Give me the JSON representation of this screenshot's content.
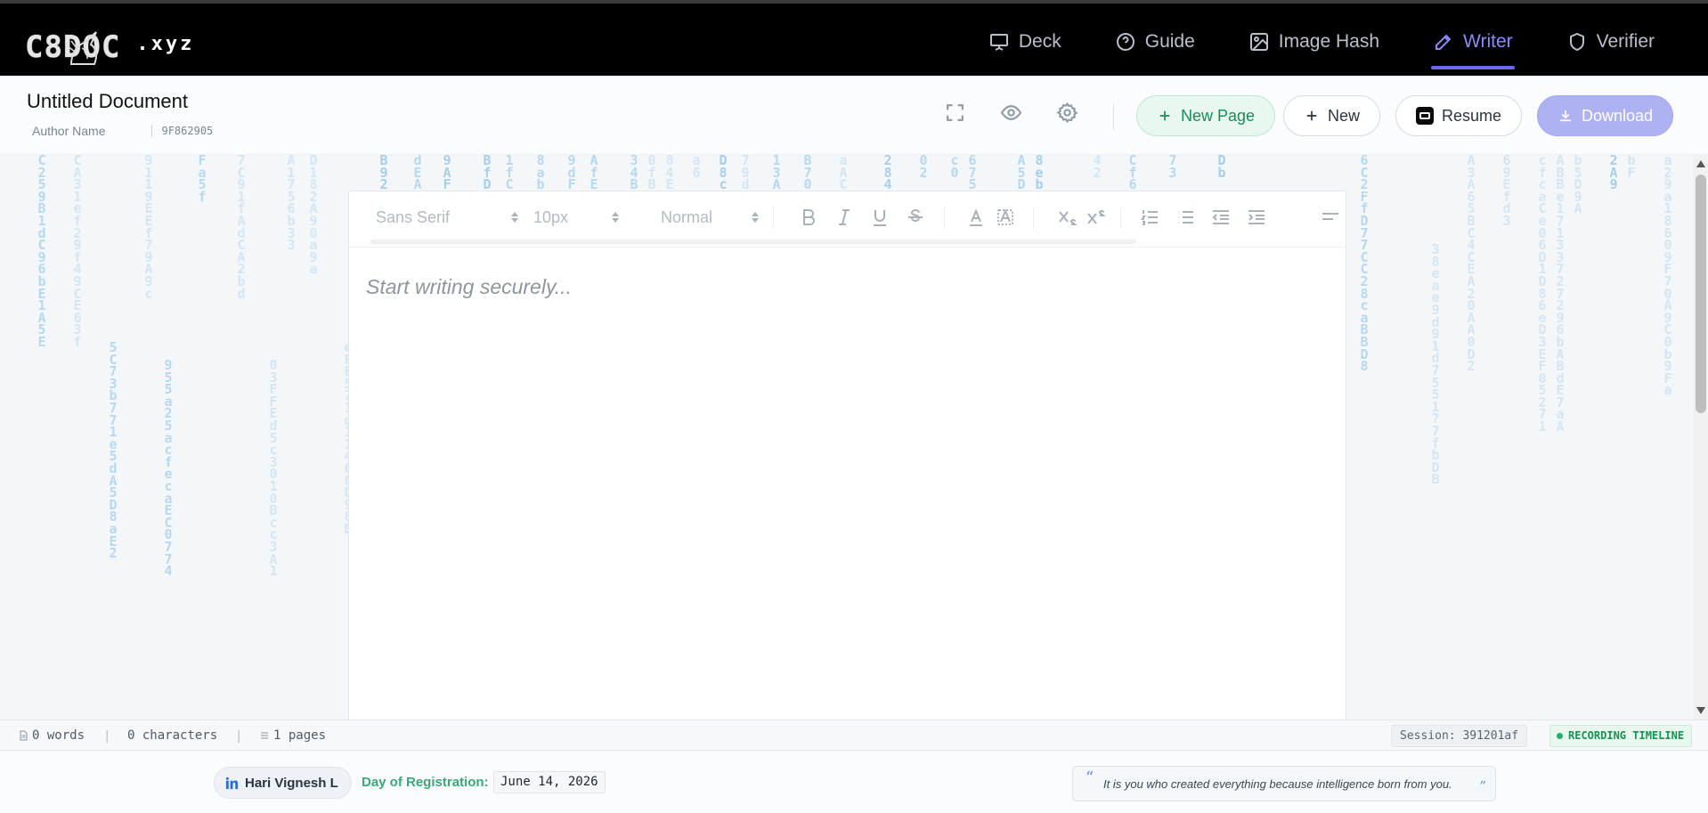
{
  "brand": {
    "logo_text": "C8DOC",
    "logo_tld": ".xyz"
  },
  "nav": [
    {
      "label": "Deck",
      "icon": "presentation-icon",
      "active": false
    },
    {
      "label": "Guide",
      "icon": "help-circle-icon",
      "active": false
    },
    {
      "label": "Image Hash",
      "icon": "image-icon",
      "active": false
    },
    {
      "label": "Writer",
      "icon": "pen-icon",
      "active": true
    },
    {
      "label": "Verifier",
      "icon": "shield-icon",
      "active": false
    }
  ],
  "document": {
    "title": "Untitled Document",
    "author_placeholder": "Author Name",
    "hash": "9F862905"
  },
  "actions": {
    "new_page": "New Page",
    "new": "New",
    "resume": "Resume",
    "download": "Download"
  },
  "toolbar": {
    "font": "Sans Serif",
    "size": "10px",
    "style": "Normal"
  },
  "editor": {
    "placeholder": "Start writing securely..."
  },
  "status": {
    "words": "0 words",
    "characters": "0 characters",
    "pages": "1 pages",
    "session": "Session: 391201af",
    "recording": "RECORDING TIMELINE"
  },
  "footer": {
    "user": "Hari Vignesh L",
    "registration_label": "Day of Registration:",
    "registration_date": "June 14, 2026",
    "quote": "It is you who created everything because intelligence born from you."
  },
  "colors": {
    "accent": "#6b68f0",
    "green": "#198c5b",
    "download_bg": "#aeb2f3",
    "nav_bg": "#000000"
  }
}
